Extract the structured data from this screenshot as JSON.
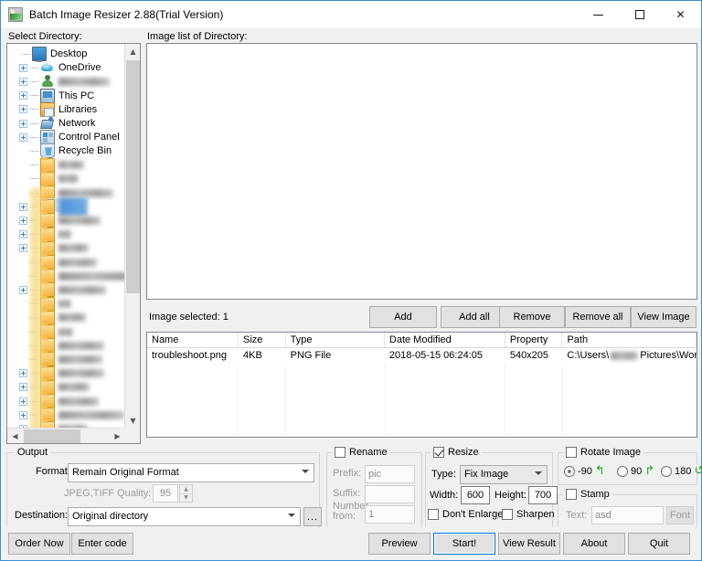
{
  "window": {
    "title": "Batch Image Resizer 2.88(Trial Version)",
    "icon": "image-app-icon",
    "minimize": "–",
    "maximize": "□",
    "close": "✕"
  },
  "panels": {
    "select_directory_label": "Select Directory:",
    "image_list_label": "Image list of Directory:"
  },
  "tree": {
    "items": [
      {
        "label": "Desktop",
        "icon": "desktop-icon",
        "indent": 0,
        "expander": "none"
      },
      {
        "label": "OneDrive",
        "icon": "onedrive-icon",
        "indent": 1,
        "expander": "plus"
      },
      {
        "label": "",
        "icon": "user-icon",
        "indent": 1,
        "expander": "plus",
        "redacted": true,
        "redact_w": 56
      },
      {
        "label": "This PC",
        "icon": "this-pc-icon",
        "indent": 1,
        "expander": "plus"
      },
      {
        "label": "Libraries",
        "icon": "libraries-icon",
        "indent": 1,
        "expander": "plus"
      },
      {
        "label": "Network",
        "icon": "network-icon",
        "indent": 1,
        "expander": "plus"
      },
      {
        "label": "Control Panel",
        "icon": "control-panel-icon",
        "indent": 1,
        "expander": "plus"
      },
      {
        "label": "Recycle Bin",
        "icon": "recycle-bin-icon",
        "indent": 1,
        "expander": "none"
      },
      {
        "label": "",
        "icon": "folder-icon",
        "indent": 1,
        "expander": "none",
        "redacted": true,
        "redact_w": 28
      },
      {
        "label": "",
        "icon": "folder-icon",
        "indent": 1,
        "expander": "none",
        "redacted": true,
        "redact_w": 22
      },
      {
        "label": "",
        "icon": "folder-icon",
        "indent": 1,
        "expander": "none",
        "redacted": true,
        "redact_w": 60
      },
      {
        "label": "",
        "icon": "folder-icon",
        "indent": 1,
        "expander": "plus",
        "redacted": true,
        "redact_w": 32,
        "selected": true
      },
      {
        "label": "",
        "icon": "folder-icon",
        "indent": 1,
        "expander": "plus",
        "redacted": true,
        "redact_w": 46
      },
      {
        "label": "",
        "icon": "folder-icon",
        "indent": 1,
        "expander": "plus",
        "redacted": true,
        "redact_w": 14
      },
      {
        "label": "",
        "icon": "folder-icon",
        "indent": 1,
        "expander": "plus",
        "redacted": true,
        "redact_w": 33
      },
      {
        "label": "",
        "icon": "folder-icon",
        "indent": 1,
        "expander": "none",
        "redacted": true,
        "redact_w": 42
      },
      {
        "label": "",
        "icon": "folder-icon",
        "indent": 1,
        "expander": "none",
        "redacted": true,
        "redact_w": 95
      },
      {
        "label": "",
        "icon": "folder-icon",
        "indent": 1,
        "expander": "plus",
        "redacted": true,
        "redact_w": 52
      },
      {
        "label": "",
        "icon": "folder-icon",
        "indent": 1,
        "expander": "none",
        "redacted": true,
        "redact_w": 14
      },
      {
        "label": "",
        "icon": "folder-icon",
        "indent": 1,
        "expander": "none",
        "redacted": true,
        "redact_w": 30
      },
      {
        "label": "",
        "icon": "folder-icon",
        "indent": 1,
        "expander": "none",
        "redacted": true,
        "redact_w": 16
      },
      {
        "label": "",
        "icon": "folder-icon",
        "indent": 1,
        "expander": "none",
        "redacted": true,
        "redact_w": 50
      },
      {
        "label": "",
        "icon": "folder-icon",
        "indent": 1,
        "expander": "none",
        "redacted": true,
        "redact_w": 48
      },
      {
        "label": "",
        "icon": "folder-icon",
        "indent": 1,
        "expander": "plus",
        "redacted": true,
        "redact_w": 50
      },
      {
        "label": "",
        "icon": "folder-icon",
        "indent": 1,
        "expander": "plus",
        "redacted": true,
        "redact_w": 34
      },
      {
        "label": "",
        "icon": "folder-icon",
        "indent": 1,
        "expander": "plus",
        "redacted": true,
        "redact_w": 44
      },
      {
        "label": "",
        "icon": "folder-icon",
        "indent": 1,
        "expander": "plus",
        "redacted": true,
        "redact_w": 72
      },
      {
        "label": "",
        "icon": "folder-icon",
        "indent": 1,
        "expander": "plus",
        "redacted": true,
        "redact_w": 32
      },
      {
        "label": "",
        "icon": "folder-icon",
        "indent": 1,
        "expander": "plus",
        "redacted": true,
        "redact_w": 92
      },
      {
        "label": "",
        "icon": "folder-icon",
        "indent": 1,
        "expander": "plus",
        "redacted": true,
        "redact_w": 14
      },
      {
        "label": "",
        "icon": "folder-icon",
        "indent": 1,
        "expander": "plus",
        "redacted": true,
        "redact_w": 42
      },
      {
        "label": "",
        "icon": "folder-icon",
        "indent": 1,
        "expander": "plus",
        "redacted": true,
        "redact_w": 30
      },
      {
        "label": "",
        "icon": "folder-icon",
        "indent": 1,
        "expander": "plus",
        "redacted": true,
        "redact_w": 48
      },
      {
        "label": "",
        "icon": "folder-icon",
        "indent": 1,
        "expander": "plus",
        "redacted": true,
        "redact_w": 20
      }
    ]
  },
  "image_actions": {
    "selected_label": "Image selected: 1",
    "buttons": [
      "Add",
      "Add all",
      "Remove",
      "Remove all",
      "View Image"
    ]
  },
  "file_table": {
    "columns": [
      {
        "label": "Name",
        "width": 109
      },
      {
        "label": "Size",
        "width": 56
      },
      {
        "label": "Type",
        "width": 118
      },
      {
        "label": "Date Modified",
        "width": 144
      },
      {
        "label": "Property",
        "width": 68
      },
      {
        "label": "Path",
        "width": 160
      }
    ],
    "rows": [
      {
        "name": "troubleshoot.png",
        "size": "4KB",
        "type": "PNG File",
        "date_modified": "2018-05-15 06:24:05",
        "property": "540x205",
        "path_prefix": "C:\\Users\\",
        "path_suffix": "Pictures\\Work pictur..."
      }
    ]
  },
  "output": {
    "title": "Output",
    "format_label": "Format:",
    "format_value": "Remain Original Format",
    "quality_label": "JPEG,TIFF Quality:",
    "quality_value": "95",
    "destination_label": "Destination:",
    "destination_value": "Original directory",
    "browse_label": "..."
  },
  "rename": {
    "title": "Rename",
    "checked": false,
    "prefix_label": "Prefix:",
    "prefix_value": "pic",
    "suffix_label": "Suffix:",
    "suffix_value": "",
    "number_label": "Number from:",
    "number_value": "1"
  },
  "resize": {
    "title": "Resize",
    "checked": true,
    "type_label": "Type:",
    "type_value": "Fix Image",
    "width_label": "Width:",
    "width_value": "600",
    "height_label": "Height:",
    "height_value": "700",
    "dont_enlarge_label": "Don't Enlarge",
    "dont_enlarge_checked": false,
    "sharpen_label": "Sharpen",
    "sharpen_checked": false
  },
  "rotate": {
    "title": "Rotate Image",
    "checked": false,
    "options": [
      {
        "label": "-90",
        "selected": true,
        "icon": "rotate-ccw-icon"
      },
      {
        "label": "90",
        "selected": false,
        "icon": "rotate-cw-icon"
      },
      {
        "label": "180",
        "selected": false,
        "icon": "rotate-180-icon"
      }
    ]
  },
  "stamp": {
    "title": "Stamp",
    "checked": false,
    "text_label": "Text:",
    "text_value": "asd",
    "font_label": "Font"
  },
  "footer": {
    "left_buttons": [
      "Order Now",
      "Enter code"
    ],
    "right_buttons": [
      "Preview",
      "Start!",
      "View Result",
      "About",
      "Quit"
    ],
    "focused": "Start!"
  },
  "colors": {
    "window_border": "#3a8fd4",
    "focus_blue": "#0078d7",
    "selection": "#cce4f7",
    "rotate_arrow_green": "#2aa52a"
  }
}
